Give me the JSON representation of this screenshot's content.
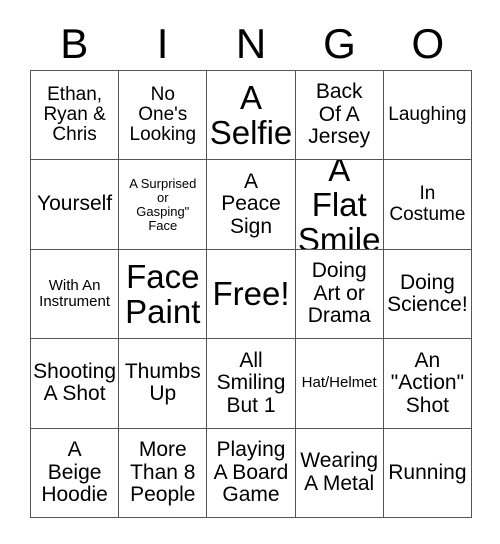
{
  "card": {
    "title": "BINGO",
    "header_letters": [
      "B",
      "I",
      "N",
      "G",
      "O"
    ],
    "free_space_label": "Free!",
    "colors": {
      "background": "#ffffff",
      "text": "#000000",
      "grid_line": "#555555"
    },
    "grid": {
      "columns": 5,
      "rows": 5,
      "cells": [
        {
          "text": "Ethan,\nRyan &\nChris",
          "size": "fs-s",
          "row": 1,
          "col": 1
        },
        {
          "text": "No\nOne's\nLooking",
          "size": "fs-s",
          "row": 1,
          "col": 2
        },
        {
          "text": "A\nSelfie",
          "size": "fs-xxl",
          "row": 1,
          "col": 3
        },
        {
          "text": "Back\nOf A\nJersey",
          "size": "fs-m",
          "row": 1,
          "col": 4
        },
        {
          "text": "Laughing",
          "size": "fs-s",
          "row": 1,
          "col": 5
        },
        {
          "text": "Yourself",
          "size": "fs-m",
          "row": 2,
          "col": 1
        },
        {
          "text": "A Surprised\nor\nGasping\"\nFace",
          "size": "fs-xxs",
          "row": 2,
          "col": 2
        },
        {
          "text": "A\nPeace\nSign",
          "size": "fs-m",
          "row": 2,
          "col": 3
        },
        {
          "text": "A Flat\nSmile",
          "size": "fs-xxl",
          "row": 2,
          "col": 4
        },
        {
          "text": "In\nCostume",
          "size": "fs-s",
          "row": 2,
          "col": 5
        },
        {
          "text": "With An\nInstrument",
          "size": "fs-xs",
          "row": 3,
          "col": 1
        },
        {
          "text": "Face\nPaint",
          "size": "fs-xxl",
          "row": 3,
          "col": 2
        },
        {
          "text": "Free!",
          "size": "fs-xxl",
          "row": 3,
          "col": 3
        },
        {
          "text": "Doing\nArt or\nDrama",
          "size": "fs-m",
          "row": 3,
          "col": 4
        },
        {
          "text": "Doing\nScience!",
          "size": "fs-m",
          "row": 3,
          "col": 5
        },
        {
          "text": "Shooting\nA Shot",
          "size": "fs-m",
          "row": 4,
          "col": 1
        },
        {
          "text": "Thumbs\nUp",
          "size": "fs-m",
          "row": 4,
          "col": 2
        },
        {
          "text": "All\nSmiling\nBut 1",
          "size": "fs-m",
          "row": 4,
          "col": 3
        },
        {
          "text": "Hat/Helmet",
          "size": "fs-xs",
          "row": 4,
          "col": 4
        },
        {
          "text": "An\n\"Action\"\nShot",
          "size": "fs-m",
          "row": 4,
          "col": 5
        },
        {
          "text": "A\nBeige\nHoodie",
          "size": "fs-m",
          "row": 5,
          "col": 1
        },
        {
          "text": "More\nThan 8\nPeople",
          "size": "fs-m",
          "row": 5,
          "col": 2
        },
        {
          "text": "Playing\nA Board\nGame",
          "size": "fs-m",
          "row": 5,
          "col": 3
        },
        {
          "text": "Wearing\nA Metal",
          "size": "fs-m",
          "row": 5,
          "col": 4
        },
        {
          "text": "Running",
          "size": "fs-m",
          "row": 5,
          "col": 5
        }
      ]
    }
  }
}
